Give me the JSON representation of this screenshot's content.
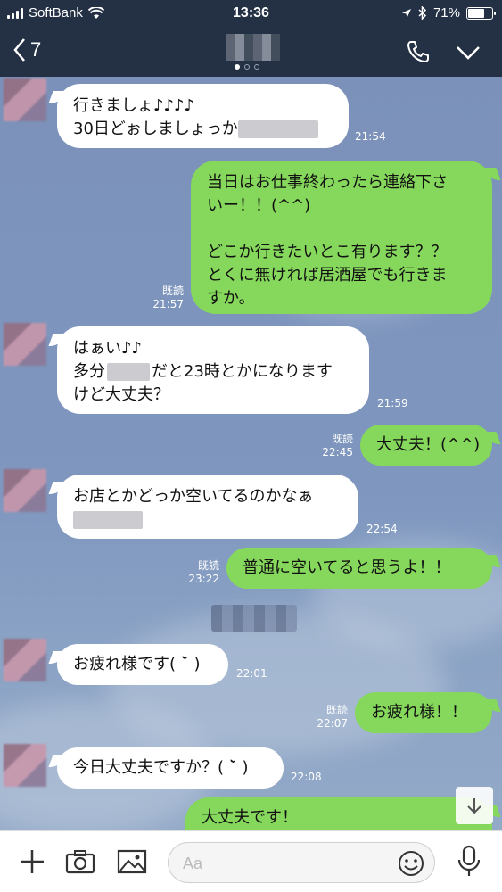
{
  "status_bar": {
    "carrier": "SoftBank",
    "time": "13:36",
    "battery_text": "71%",
    "battery_level": 0.71
  },
  "header": {
    "back_count": "7"
  },
  "messages": [
    {
      "side": "in",
      "lines": [
        "行きましょ♪♪♪♪",
        "30日どぉしましょっか"
      ],
      "time": "21:54"
    },
    {
      "side": "out",
      "lines": [
        "当日はお仕事終わったら連絡下さ",
        "いー！！(^^)",
        "",
        "どこか行きたいとこ有ります？？",
        "とくに無ければ居酒屋でも行きま",
        "すか。"
      ],
      "read": "既読",
      "time": "21:57"
    },
    {
      "side": "in",
      "lines": [
        "はぁい♪♪",
        "多分",
        "けど大丈夫？"
      ],
      "line2_suffix": "だと23時とかになります",
      "time": "21:59"
    },
    {
      "side": "out",
      "lines": [
        "大丈夫！(^^)"
      ],
      "read": "既読",
      "time": "22:45"
    },
    {
      "side": "in",
      "lines": [
        "お店とかどっか空いてるのかなぁ"
      ],
      "time": "22:54"
    },
    {
      "side": "out",
      "lines": [
        "普通に空いてると思うよ！！"
      ],
      "read": "既読",
      "time": "23:22"
    },
    {
      "side": "in",
      "lines": [
        "お疲れ様です( ˘̀ )"
      ],
      "time": "22:01"
    },
    {
      "side": "out",
      "lines": [
        "お疲れ様！！"
      ],
      "read": "既読",
      "time": "22:07"
    },
    {
      "side": "in",
      "lines": [
        "今日大丈夫ですか？( ˘̀ )"
      ],
      "time": "22:08"
    },
    {
      "side": "out",
      "lines": [
        "大丈夫です！"
      ]
    }
  ],
  "composer": {
    "placeholder": "Aa"
  },
  "icons": {
    "back": "chevron-left-icon",
    "call": "phone-icon",
    "menu": "chevron-down-icon",
    "add": "plus-icon",
    "camera": "camera-icon",
    "image": "image-icon",
    "emoji": "smiley-icon",
    "mic": "microphone-icon",
    "scroll": "arrow-down-icon"
  },
  "colors": {
    "header_bg": "#243044",
    "incoming_bubble": "#ffffff",
    "outgoing_bubble": "#86d85c"
  }
}
